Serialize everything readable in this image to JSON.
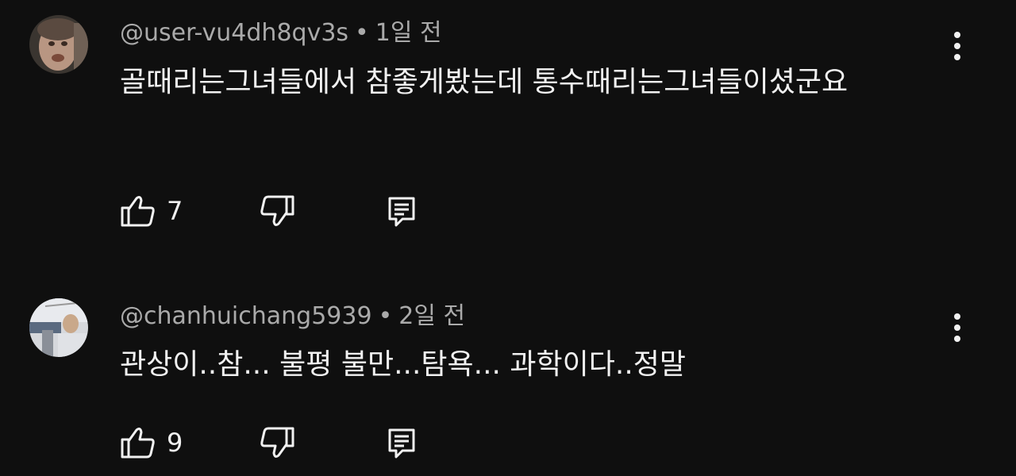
{
  "comments": [
    {
      "handle": "@user-vu4dh8qv3s",
      "separator": "•",
      "time": "1일 전",
      "text": "골때리는그녀들에서 참좋게봤는데 통수때리는그녀들이셨군요",
      "likes": "7",
      "avatar_icon": "user-avatar-1"
    },
    {
      "handle": "@chanhuichang5939",
      "separator": "•",
      "time": "2일 전",
      "text": "관상이..참... 불평 불만...탐욕... 과학이다..정말",
      "likes": "9",
      "avatar_icon": "user-avatar-2"
    }
  ],
  "icons": {
    "like": "thumbs-up-icon",
    "dislike": "thumbs-down-icon",
    "reply": "reply-icon",
    "more": "more-vertical-icon"
  },
  "colors": {
    "background": "#0f0f0f",
    "text": "#f1f1f1",
    "meta": "#aaaaaa"
  }
}
